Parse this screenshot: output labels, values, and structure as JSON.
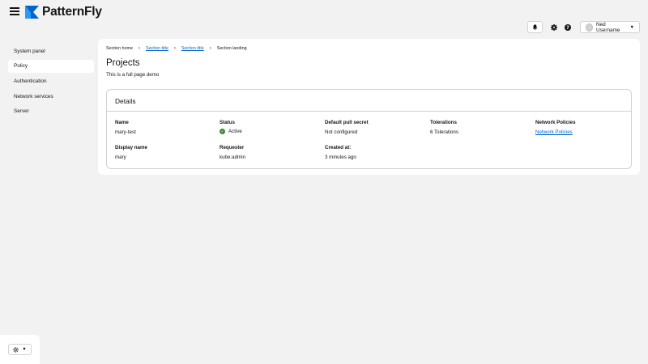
{
  "brand": {
    "name": "PatternFly",
    "icon": "patternfly-logo-icon"
  },
  "header": {
    "notification_icon": "bell-icon",
    "settings_icon": "gear-icon",
    "help_icon": "question-circle-icon",
    "user": {
      "name": "Ned Username",
      "caret": "▼"
    }
  },
  "sidebar": {
    "items": [
      {
        "label": "System panel"
      },
      {
        "label": "Policy",
        "active": true
      },
      {
        "label": "Authentication"
      },
      {
        "label": "Network services"
      },
      {
        "label": "Server"
      }
    ]
  },
  "breadcrumb": {
    "home": "Section home",
    "title1": "Section title",
    "title2": "Section title",
    "landing": "Section landing"
  },
  "page": {
    "title": "Projects",
    "description": "This is a full page demo"
  },
  "details": {
    "title": "Details",
    "name_label": "Name",
    "name_value": "mary-test",
    "status_label": "Status",
    "status_value": "Active",
    "pull_secret_label": "Default pull secret",
    "pull_secret_value": "Not configured",
    "tolerations_label": "Tolerations",
    "tolerations_value": "6 Tolerations",
    "network_policies_label": "Network Policies",
    "network_policies_value": "Network Policies",
    "display_name_label": "Display name",
    "display_name_value": "mary",
    "requester_label": "Requester",
    "requester_value": "kube:admin",
    "created_label": "Created at:",
    "created_value": "3 minutes ago"
  },
  "colors": {
    "link": "#0066cc",
    "success": "#3e8635",
    "background": "#f2f2f2"
  },
  "theme_switcher": {
    "icon": "sun-icon",
    "caret": "▼"
  }
}
